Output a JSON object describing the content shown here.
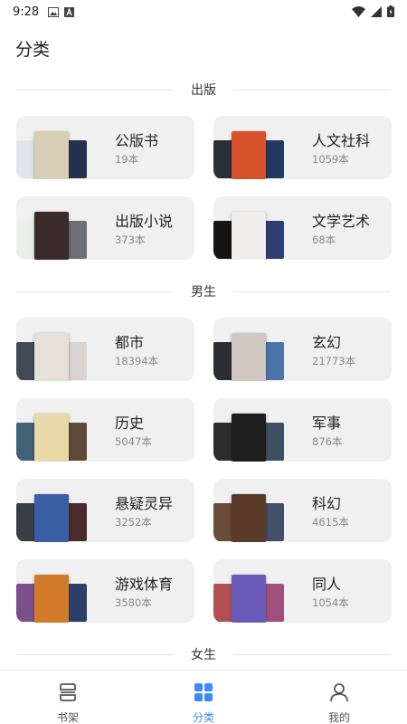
{
  "status_bar": {
    "time": "9:28"
  },
  "page": {
    "title": "分类"
  },
  "sections": [
    {
      "title": "出版",
      "categories": [
        {
          "name": "公版书",
          "count": "19本",
          "covers": [
            "#dfe6ea",
            "#d8cdb5",
            "#23324f"
          ]
        },
        {
          "name": "人文社科",
          "count": "1059本",
          "covers": [
            "#2b2f35",
            "#d7522a",
            "#213a63"
          ]
        },
        {
          "name": "出版小说",
          "count": "373本",
          "covers": [
            "#eaf0ea",
            "#3a2a2a",
            "#6d6f78"
          ]
        },
        {
          "name": "文学艺术",
          "count": "68本",
          "covers": [
            "#151515",
            "#f0eeec",
            "#2b3f72"
          ]
        }
      ]
    },
    {
      "title": "男生",
      "categories": [
        {
          "name": "都市",
          "count": "18394本",
          "covers": [
            "#3f4a55",
            "#e6e0d8",
            "#d9d4cf"
          ]
        },
        {
          "name": "玄幻",
          "count": "21773本",
          "covers": [
            "#2b2d33",
            "#cfc7c0",
            "#4d74a8"
          ]
        },
        {
          "name": "历史",
          "count": "5047本",
          "covers": [
            "#3f6275",
            "#e9d9a8",
            "#5e4a3a"
          ]
        },
        {
          "name": "军事",
          "count": "876本",
          "covers": [
            "#2d2d2d",
            "#1e1e1e",
            "#3f4f63"
          ]
        },
        {
          "name": "悬疑灵异",
          "count": "3252本",
          "covers": [
            "#3a3f47",
            "#3b5fa5",
            "#4a2c2c"
          ]
        },
        {
          "name": "科幻",
          "count": "4615本",
          "covers": [
            "#6a4c3a",
            "#5a3a28",
            "#43506a"
          ]
        },
        {
          "name": "游戏体育",
          "count": "3580本",
          "covers": [
            "#7a4f8a",
            "#d17a2a",
            "#2c3e6a"
          ]
        },
        {
          "name": "同人",
          "count": "1054本",
          "covers": [
            "#b24f4f",
            "#6a5ab8",
            "#a14f7d"
          ]
        }
      ]
    },
    {
      "title": "女生",
      "categories": []
    }
  ],
  "bottom_nav": {
    "items": [
      {
        "label": "书架",
        "icon": "bookshelf-icon",
        "active": false
      },
      {
        "label": "分类",
        "icon": "category-grid-icon",
        "active": true
      },
      {
        "label": "我的",
        "icon": "user-profile-icon",
        "active": false
      }
    ]
  },
  "colors": {
    "accent": "#3d8cf5",
    "card_bg": "#f0f0f0"
  }
}
